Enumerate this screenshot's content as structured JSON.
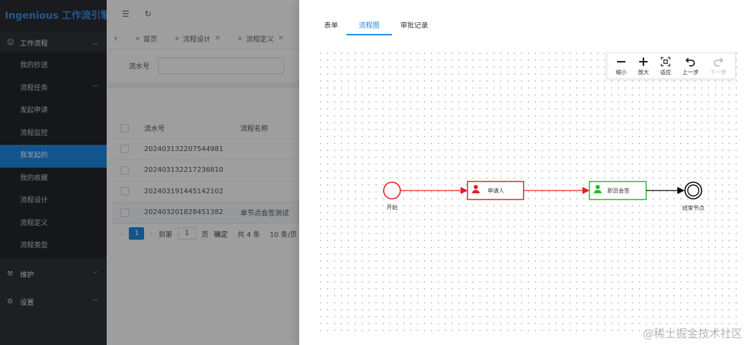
{
  "app": {
    "brand": "Ingenious 工作流引擎"
  },
  "sidebar": {
    "group_flow": {
      "label": "工作流程",
      "icon": "smile-icon"
    },
    "items": [
      {
        "label": "我的抄送"
      },
      {
        "label": "流程任务",
        "has_children": true
      },
      {
        "label": "发起申请"
      },
      {
        "label": "流程监控"
      },
      {
        "label": "我发起的",
        "active": true
      },
      {
        "label": "我的收藏"
      },
      {
        "label": "流程设计"
      },
      {
        "label": "流程定义"
      },
      {
        "label": "流程类型"
      }
    ],
    "group_maint": {
      "label": "维护",
      "icon": "tools-icon"
    },
    "group_settings": {
      "label": "设置",
      "icon": "gear-icon"
    }
  },
  "tabs": [
    {
      "label": "首页"
    },
    {
      "label": "流程设计"
    },
    {
      "label": "流程定义"
    }
  ],
  "filter": {
    "serial_label": "流水号"
  },
  "table": {
    "headers": [
      "流水号",
      "流程名称"
    ],
    "rows": [
      {
        "serial": "202403132207544981",
        "name": ""
      },
      {
        "serial": "202403132217236810",
        "name": ""
      },
      {
        "serial": "202403191445142102",
        "name": ""
      },
      {
        "serial": "202403201828451382",
        "name": "单节点会签测试"
      }
    ]
  },
  "pager": {
    "current": "1",
    "goto_label": "到第",
    "page_input": "1",
    "page_unit": "页",
    "confirm": "确定",
    "total": "共 4 条",
    "page_size": "10 条/页"
  },
  "drawer": {
    "tabs": [
      {
        "label": "表单"
      },
      {
        "label": "流程图",
        "active": true
      },
      {
        "label": "审批记录"
      }
    ],
    "toolbar": {
      "zoom_out": "缩小",
      "zoom_in": "放大",
      "fit": "适应",
      "undo": "上一步",
      "redo": "下一步"
    },
    "flow": {
      "start_label": "开始",
      "task1_label": "申请人",
      "task2_label": "职员会签",
      "end_label": "结束节点",
      "colors": {
        "active": "#e02020",
        "done": "#22bb22",
        "pending": "#000000"
      }
    }
  },
  "watermark": "@稀土掘金技术社区"
}
